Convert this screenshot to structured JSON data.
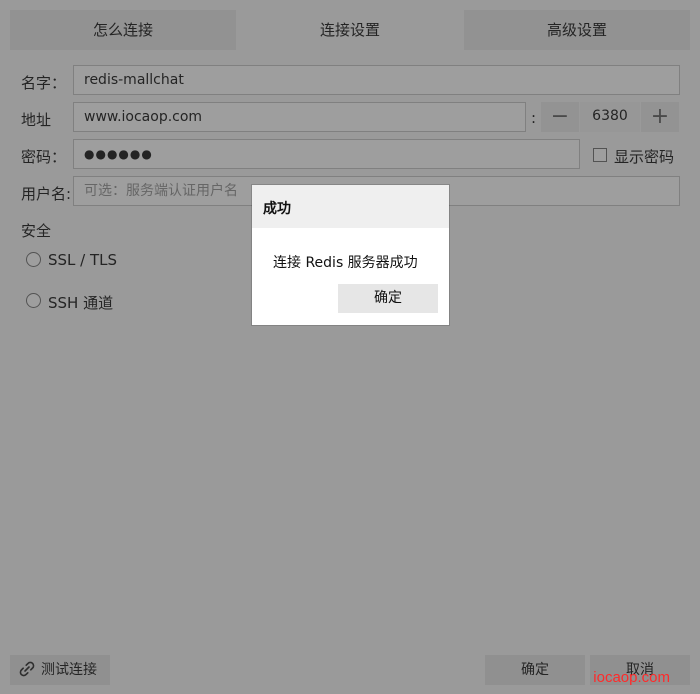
{
  "tabs": [
    {
      "label": "怎么连接"
    },
    {
      "label": "连接设置"
    },
    {
      "label": "高级设置"
    }
  ],
  "form": {
    "name_label": "名字：",
    "name_value": "redis-mallchat",
    "address_label": "地址",
    "host_value": "www.iocaop.com",
    "port_separator": ":",
    "port_value": "6380",
    "password_label": "密码：",
    "password_value": "●●●●●●",
    "show_password_label": "显示密码",
    "username_label": "用户名:",
    "username_placeholder": "可选：服务端认证用户名"
  },
  "security": {
    "heading": "安全",
    "options": [
      {
        "label": "SSL / TLS"
      },
      {
        "label": "SSH 通道"
      }
    ]
  },
  "footer": {
    "test_label": "测试连接",
    "ok_label": "确定",
    "cancel_label": "取消"
  },
  "dialog": {
    "title": "成功",
    "message": "连接 Redis 服务器成功",
    "ok_label": "确定"
  },
  "watermark": "iocaop.com"
}
